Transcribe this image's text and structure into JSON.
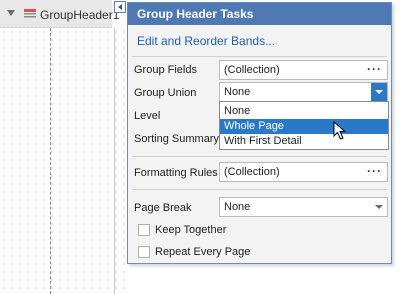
{
  "band": {
    "name": "GroupHeader1"
  },
  "panel": {
    "title": "Group Header Tasks",
    "link_label": "Edit and Reorder Bands...",
    "group_fields": {
      "label": "Group Fields",
      "value": "(Collection)"
    },
    "group_union": {
      "label": "Group Union",
      "value": "None",
      "options": [
        "None",
        "Whole Page",
        "With First Detail"
      ],
      "highlighted_option": "Whole Page"
    },
    "level": {
      "label": "Level"
    },
    "sorting_summary": {
      "label": "Sorting Summary"
    },
    "formatting_rules": {
      "label": "Formatting Rules",
      "value": "(Collection)"
    },
    "page_break": {
      "label": "Page Break",
      "value": "None"
    },
    "keep_together": {
      "label": "Keep Together",
      "checked": false
    },
    "repeat_every_page": {
      "label": "Repeat Every Page",
      "checked": false
    }
  },
  "icons": {
    "band_expander": "triangle-down-icon",
    "band_icon": "group-header-band-icon",
    "smart_tag": "chevron-left-icon",
    "ellipsis": "ellipsis-icon",
    "dropdown": "chevron-down-icon",
    "cursor": "mouse-pointer-icon"
  },
  "colors": {
    "title_bar": "#4f79b4",
    "link": "#1f5fb0",
    "selection": "#2a79c9",
    "panel_bg": "#f3f3f3"
  }
}
